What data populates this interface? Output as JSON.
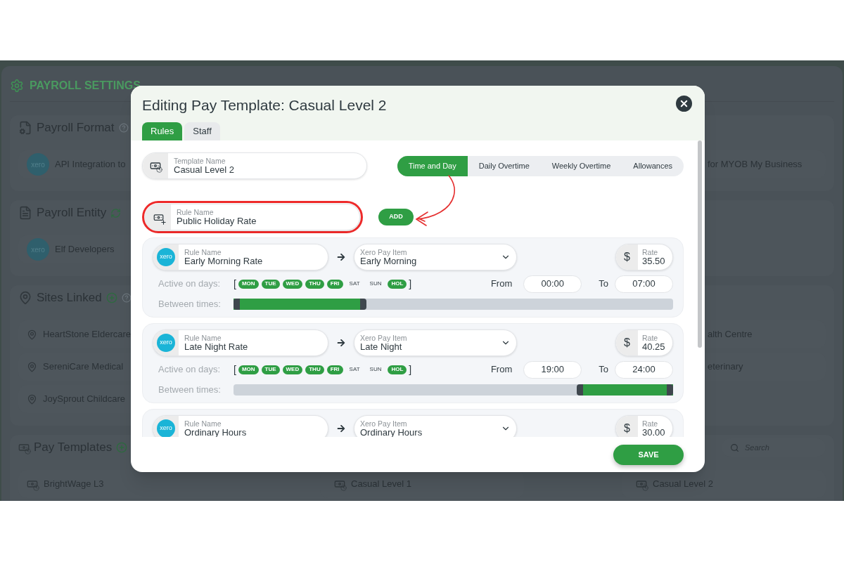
{
  "background": {
    "title": "PAYROLL SETTINGS",
    "sections": [
      {
        "kind": "format",
        "title": "Payroll Format",
        "rows": [
          {
            "left": {
              "logo": "xero",
              "label": "API Integration to"
            },
            "right": {
              "label": "for MYOB My Business"
            }
          }
        ]
      },
      {
        "kind": "entity",
        "title": "Payroll Entity",
        "rows": [
          {
            "left": {
              "logo": "xero",
              "label": "Elf Developers"
            }
          }
        ]
      },
      {
        "kind": "sites",
        "title": "Sites Linked",
        "rows": [
          {
            "left": {
              "label": "HeartStone Eldercare"
            },
            "right": {
              "label": "alth Centre"
            }
          },
          {
            "left": {
              "label": "SereniCare Medical"
            },
            "right": {
              "label": "eterinary"
            }
          },
          {
            "left": {
              "label": "JoySprout Childcare"
            }
          }
        ]
      },
      {
        "kind": "templates",
        "title": "Pay Templates",
        "search": {
          "placeholder": "Search"
        },
        "rows": [
          {
            "left": {
              "label": "BrightWage L3"
            },
            "middle": {
              "label": "Casual Level 1"
            },
            "right": {
              "label": "Casual Level 2"
            }
          }
        ]
      }
    ]
  },
  "modal": {
    "title": "Editing Pay Template: Casual Level 2",
    "tabs": [
      {
        "label": "Rules",
        "selected": true
      },
      {
        "label": "Staff",
        "selected": false
      }
    ],
    "template_name": {
      "label": "Template Name",
      "value": "Casual Level 2"
    },
    "rule_tabs": [
      {
        "label": "Time and Day",
        "selected": true
      },
      {
        "label": "Daily Overtime",
        "selected": false
      },
      {
        "label": "Weekly Overtime",
        "selected": false
      },
      {
        "label": "Allowances",
        "selected": false
      }
    ],
    "new_rule": {
      "label": "Rule Name",
      "value": "Public Holiday Rate",
      "highlighted": true
    },
    "add_button": "ADD",
    "rules": [
      {
        "logo": "xero",
        "name_label": "Rule Name",
        "name": "Early Morning Rate",
        "pay_item_label": "Xero Pay Item",
        "pay_item": "Early Morning",
        "currency": "$",
        "rate_label": "Rate",
        "rate": "35.50",
        "days_label": "Active on days:",
        "bracket_open": "[",
        "bracket_close": "]",
        "days": [
          {
            "label": "MON",
            "on": true
          },
          {
            "label": "TUE",
            "on": true
          },
          {
            "label": "WED",
            "on": true
          },
          {
            "label": "THU",
            "on": true
          },
          {
            "label": "FRI",
            "on": true
          },
          {
            "label": "SAT",
            "on": false
          },
          {
            "label": "SUN",
            "on": false
          },
          {
            "label": "HOL",
            "on": true
          }
        ],
        "from_label": "From",
        "from": "00:00",
        "to_label": "To",
        "to": "07:00",
        "times_label": "Between times:",
        "range": {
          "start": {
            "level": 0
          },
          "end": {
            "level": 0.2917
          }
        }
      },
      {
        "logo": "xero",
        "name_label": "Rule Name",
        "name": "Late Night Rate",
        "pay_item_label": "Xero Pay Item",
        "pay_item": "Late Night",
        "currency": "$",
        "rate_label": "Rate",
        "rate": "40.25",
        "days_label": "Active on days:",
        "bracket_open": "[",
        "bracket_close": "]",
        "days": [
          {
            "label": "MON",
            "on": true
          },
          {
            "label": "TUE",
            "on": true
          },
          {
            "label": "WED",
            "on": true
          },
          {
            "label": "THU",
            "on": true
          },
          {
            "label": "FRI",
            "on": true
          },
          {
            "label": "SAT",
            "on": false
          },
          {
            "label": "SUN",
            "on": false
          },
          {
            "label": "HOL",
            "on": true
          }
        ],
        "from_label": "From",
        "from": "19:00",
        "to_label": "To",
        "to": "24:00",
        "times_label": "Between times:",
        "range": {
          "start": {
            "level": 0.7917
          },
          "end": {
            "level": 1
          }
        }
      },
      {
        "logo": "xero",
        "name_label": "Rule Name",
        "name": "Ordinary Hours",
        "pay_item_label": "Xero Pay Item",
        "pay_item": "Ordinary Hours",
        "currency": "$",
        "rate_label": "Rate",
        "rate": "30.00"
      }
    ],
    "save_button": "SAVE"
  }
}
